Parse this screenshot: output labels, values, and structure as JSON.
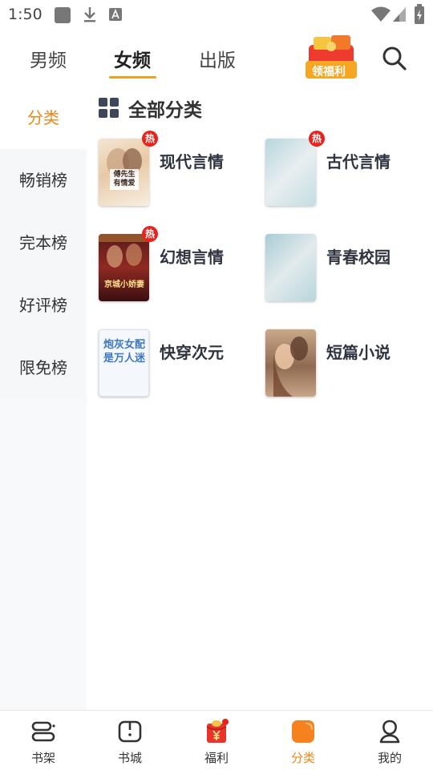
{
  "status_bar": {
    "time": "1:50"
  },
  "top_tabs": [
    {
      "label": "男频"
    },
    {
      "label": "女频"
    },
    {
      "label": "出版"
    }
  ],
  "welfare_badge": {
    "label": "领福利"
  },
  "sidebar": {
    "items": [
      {
        "label": "分类"
      },
      {
        "label": "畅销榜"
      },
      {
        "label": "完本榜"
      },
      {
        "label": "好评榜"
      },
      {
        "label": "限免榜"
      }
    ]
  },
  "main": {
    "section_title": "全部分类",
    "categories": [
      {
        "label": "现代言情",
        "hot": "热",
        "cover_text": "傅先生 有情爱"
      },
      {
        "label": "古代言情",
        "hot": "热"
      },
      {
        "label": "幻想言情",
        "hot": "热",
        "cover_text": "京城小娇妻"
      },
      {
        "label": "青春校园"
      },
      {
        "label": "快穿次元",
        "cover_text": "炮灰女配是万人迷"
      },
      {
        "label": "短篇小说"
      }
    ]
  },
  "bottom_nav": [
    {
      "label": "书架",
      "icon": "bookshelf-icon"
    },
    {
      "label": "书城",
      "icon": "bookstore-icon"
    },
    {
      "label": "福利",
      "icon": "welfare-redpacket-icon"
    },
    {
      "label": "分类",
      "icon": "category-icon"
    },
    {
      "label": "我的",
      "icon": "profile-icon"
    }
  ],
  "colors": {
    "accent": "#f08519",
    "hot": "#e8231c"
  }
}
